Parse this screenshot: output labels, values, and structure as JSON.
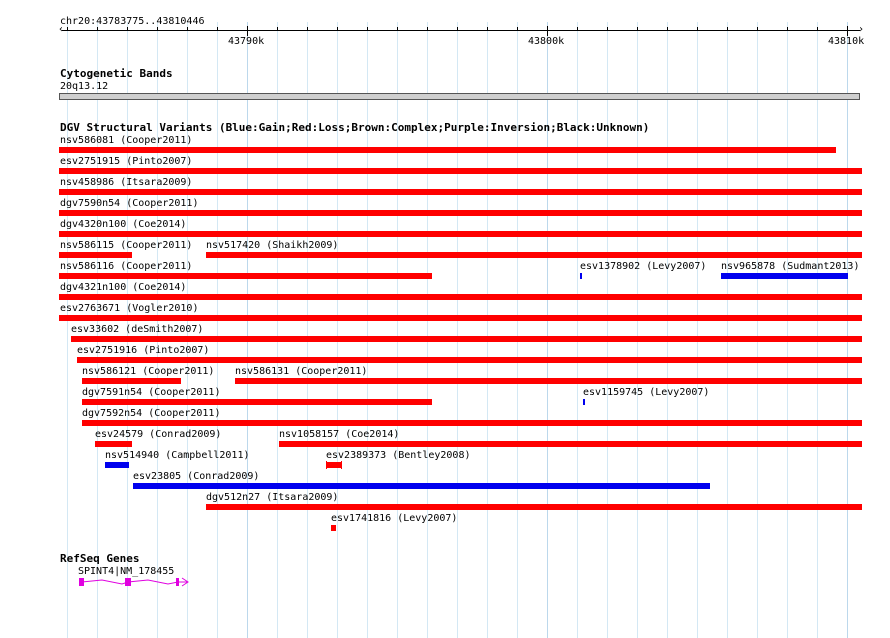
{
  "ruler": {
    "region": "chr20:43783775..43810446",
    "tick_labels": [
      "43790k",
      "43800k",
      "43810k"
    ]
  },
  "cytoband": {
    "title": "Cytogenetic Bands",
    "band": "20q13.12"
  },
  "dgv": {
    "title": "DGV Structural Variants (Blue:Gain;Red:Loss;Brown:Complex;Purple:Inversion;Black:Unknown)",
    "colors": {
      "loss": "#ff0000",
      "gain": "#0000ee"
    },
    "variants": [
      {
        "label": "nsv586081 (Cooper2011)",
        "type": "loss",
        "row": 0
      },
      {
        "label": "esv2751915 (Pinto2007)",
        "type": "loss",
        "row": 1
      },
      {
        "label": "nsv458986 (Itsara2009)",
        "type": "loss",
        "row": 2
      },
      {
        "label": "dgv7590n54 (Cooper2011)",
        "type": "loss",
        "row": 3
      },
      {
        "label": "dgv4320n100 (Coe2014)",
        "type": "loss",
        "row": 4
      },
      {
        "label": "nsv586115 (Cooper2011)",
        "type": "loss",
        "row": 5
      },
      {
        "label": "nsv517420 (Shaikh2009)",
        "type": "loss",
        "row": 5
      },
      {
        "label": "nsv586116 (Cooper2011)",
        "type": "loss",
        "row": 6
      },
      {
        "label": "esv1378902 (Levy2007)",
        "type": "gain",
        "row": 6
      },
      {
        "label": "nsv965878 (Sudmant2013)",
        "type": "gain",
        "row": 6
      },
      {
        "label": "dgv4321n100 (Coe2014)",
        "type": "loss",
        "row": 7
      },
      {
        "label": "esv2763671 (Vogler2010)",
        "type": "loss",
        "row": 8
      },
      {
        "label": "esv33602 (deSmith2007)",
        "type": "loss",
        "row": 9
      },
      {
        "label": "esv2751916 (Pinto2007)",
        "type": "loss",
        "row": 10
      },
      {
        "label": "nsv586121 (Cooper2011)",
        "type": "loss",
        "row": 11
      },
      {
        "label": "nsv586131 (Cooper2011)",
        "type": "loss",
        "row": 11
      },
      {
        "label": "dgv7591n54 (Cooper2011)",
        "type": "loss",
        "row": 12
      },
      {
        "label": "esv1159745 (Levy2007)",
        "type": "gain",
        "row": 12
      },
      {
        "label": "dgv7592n54 (Cooper2011)",
        "type": "loss",
        "row": 13
      },
      {
        "label": "esv24579 (Conrad2009)",
        "type": "loss",
        "row": 14
      },
      {
        "label": "nsv1058157 (Coe2014)",
        "type": "loss",
        "row": 14
      },
      {
        "label": "nsv514940 (Campbell2011)",
        "type": "gain",
        "row": 15
      },
      {
        "label": "esv2389373 (Bentley2008)",
        "type": "loss",
        "row": 15
      },
      {
        "label": "esv23805 (Conrad2009)",
        "type": "gain",
        "row": 16
      },
      {
        "label": "dgv512n27 (Itsara2009)",
        "type": "loss",
        "row": 17
      },
      {
        "label": "esv1741816 (Levy2007)",
        "type": "loss",
        "row": 18
      }
    ]
  },
  "refseq": {
    "title": "RefSeq Genes",
    "gene_label": "SPINT4|NM_178455",
    "color": "#e000e0"
  }
}
